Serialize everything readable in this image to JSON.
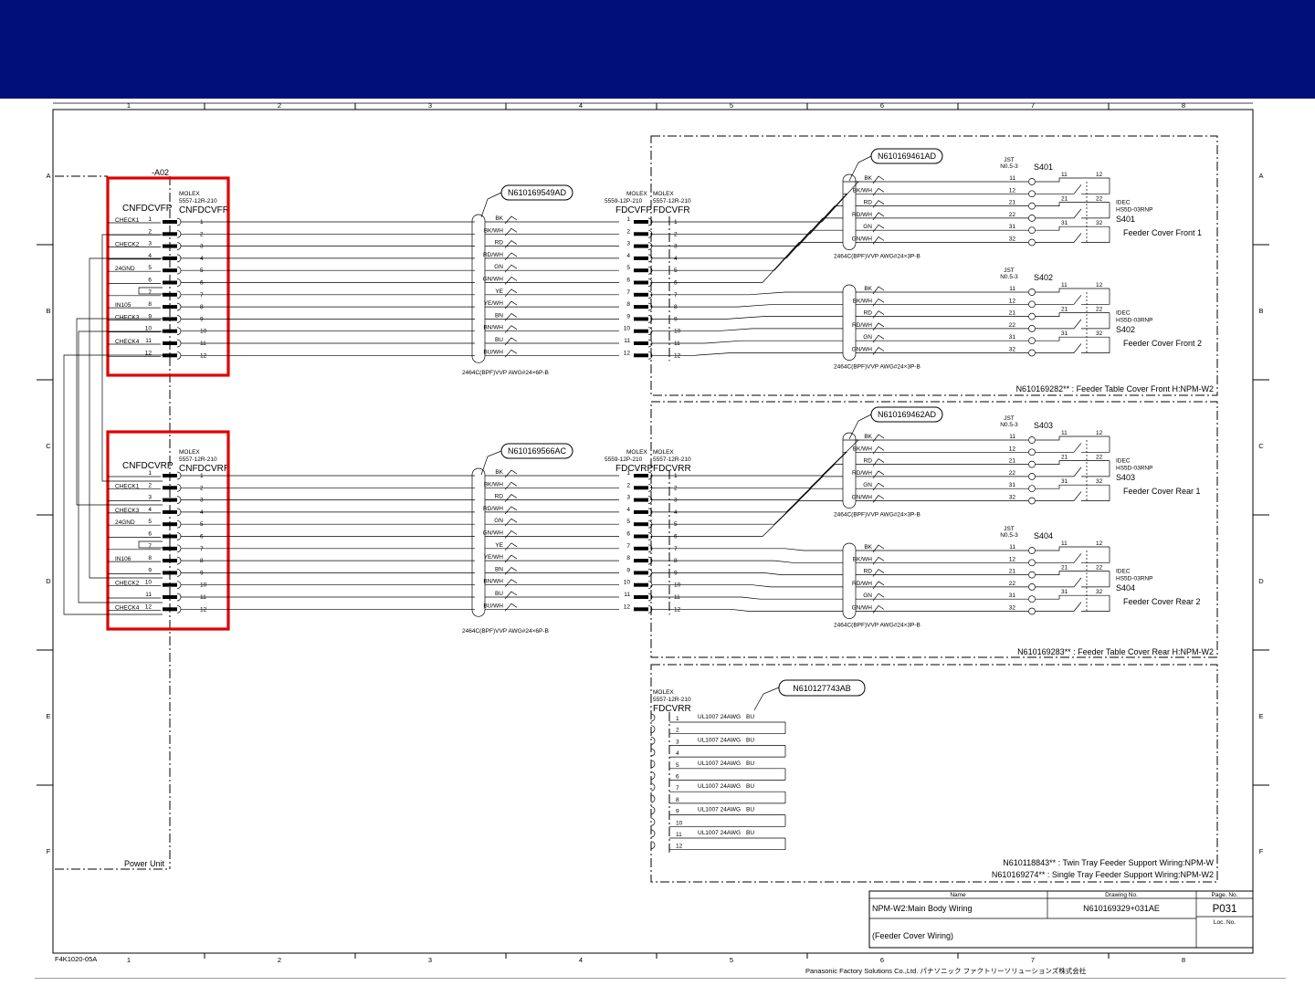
{
  "colors": {
    "header_bar": "#000f7a",
    "highlight_box": "#e00000",
    "ink": "#000000"
  },
  "sheet": {
    "col_labels": [
      "1",
      "2",
      "3",
      "4",
      "5",
      "6",
      "7",
      "8"
    ],
    "row_labels": [
      "A",
      "B",
      "C",
      "D",
      "E",
      "F"
    ],
    "form_code": "F4K1020-05A",
    "company": "Panasonic Factory Solutions Co.,Ltd. パナソニック ファクトリーソリューションズ株式会社"
  },
  "left": {
    "a02": "-A02",
    "power_unit": "Power Unit",
    "front": {
      "connector": "CNFDCVFP",
      "header1": "MOLEX",
      "header2": "5557-12R-210",
      "connector_r": "CNFDCVFR",
      "signal_labels": [
        {
          "pin": 1,
          "text": "CHECK1"
        },
        {
          "pin": 3,
          "text": "CHECK2"
        },
        {
          "pin": 5,
          "text": "24GND"
        },
        {
          "pin": 8,
          "text": "IN105"
        },
        {
          "pin": 9,
          "text": "CHECK3"
        },
        {
          "pin": 11,
          "text": "CHECK4"
        }
      ]
    },
    "rear": {
      "connector": "CNFDCVRP",
      "header1": "MOLEX",
      "header2": "5557-12R-210",
      "connector_r": "CNFDCVRR",
      "signal_labels": [
        {
          "pin": 2,
          "text": "CHECK1"
        },
        {
          "pin": 4,
          "text": "CHECK3"
        },
        {
          "pin": 5,
          "text": "24GND"
        },
        {
          "pin": 8,
          "text": "IN106"
        },
        {
          "pin": 10,
          "text": "CHECK2"
        },
        {
          "pin": 12,
          "text": "CHECK4"
        }
      ]
    },
    "pins": [
      "1",
      "2",
      "3",
      "4",
      "5",
      "6",
      "7",
      "8",
      "9",
      "10",
      "11",
      "12"
    ]
  },
  "cables": {
    "front_id": "N610169549AD",
    "rear_id": "N610169566AC",
    "wire_colors": [
      "BK",
      "BK/WH",
      "RD",
      "RD/WH",
      "GN",
      "GN/WH",
      "YE",
      "YE/WH",
      "BN",
      "BN/WH",
      "BU",
      "BU/WH"
    ],
    "spec": "2464C(BPF)VVP AWG#24×6P-B"
  },
  "mid_connectors": {
    "front_left_1": "MOLEX",
    "front_left_2": "5559-12P-210",
    "front_left_3": "FDCVFP",
    "front_right_1": "MOLEX",
    "front_right_2": "5557-12R-210",
    "front_right_3": "FDCVFR",
    "rear_left_1": "MOLEX",
    "rear_left_2": "5559-12P-210",
    "rear_left_3": "FDCVRP",
    "rear_right_1": "MOLEX",
    "rear_right_2": "5557-12R-210",
    "rear_right_3": "FDCVRR"
  },
  "switch_groups": [
    {
      "cable": "N610169461AD",
      "switches": [
        {
          "name": "S401",
          "desc": "Feeder Cover Front 1"
        },
        {
          "name": "S402",
          "desc": "Feeder Cover Front 2"
        }
      ]
    },
    {
      "cable": "N610169462AD",
      "switches": [
        {
          "name": "S403",
          "desc": "Feeder Cover Rear 1"
        },
        {
          "name": "S404",
          "desc": "Feeder Cover Rear 2"
        }
      ]
    }
  ],
  "switch_common": {
    "jst1": "JST",
    "jst2": "N0.5-3",
    "terms": [
      "11",
      "12",
      "21",
      "22",
      "31",
      "32"
    ],
    "wire_colors": [
      "BK",
      "BK/WH",
      "RD",
      "RD/WH",
      "GN",
      "GN/WH"
    ],
    "idec1": "IDEC",
    "idec2": "HS5D-03RNP",
    "cable_spec": "2464C(BPF)VVP AWG#24×3P-B",
    "contact_labels": [
      "11",
      "12",
      "21",
      "22",
      "31",
      "32"
    ]
  },
  "region_notes": {
    "front": "N610169282** : Feeder Table Cover Front H:NPM-W2",
    "rear": "N610169283** : Feeder Table Cover Rear H:NPM-W2"
  },
  "jumper": {
    "cable": "N610127743AB",
    "h1": "MOLEX",
    "h2": "5557-12R-210",
    "h3": "FDCVRR",
    "pins": [
      "1",
      "2",
      "3",
      "4",
      "5",
      "6",
      "7",
      "8",
      "9",
      "10",
      "11",
      "12"
    ],
    "wire_label": "UL1007 24AWG",
    "wire_color": "BU",
    "note1": "N610118843** : Twin Tray Feeder Support Wiring:NPM-W",
    "note2": "N610169274** : Single Tray Feeder Support Wiring:NPM-W2"
  },
  "title_block": {
    "name_header": "Name",
    "drawing_header": "Drawing No.",
    "page_header": "Page. No.",
    "name": "NPM-W2:Main Body Wiring",
    "subname": "(Feeder Cover Wiring)",
    "drawing_no": "N610169329+031AE",
    "page_no": "P031",
    "loc_header": "Loc. No."
  }
}
